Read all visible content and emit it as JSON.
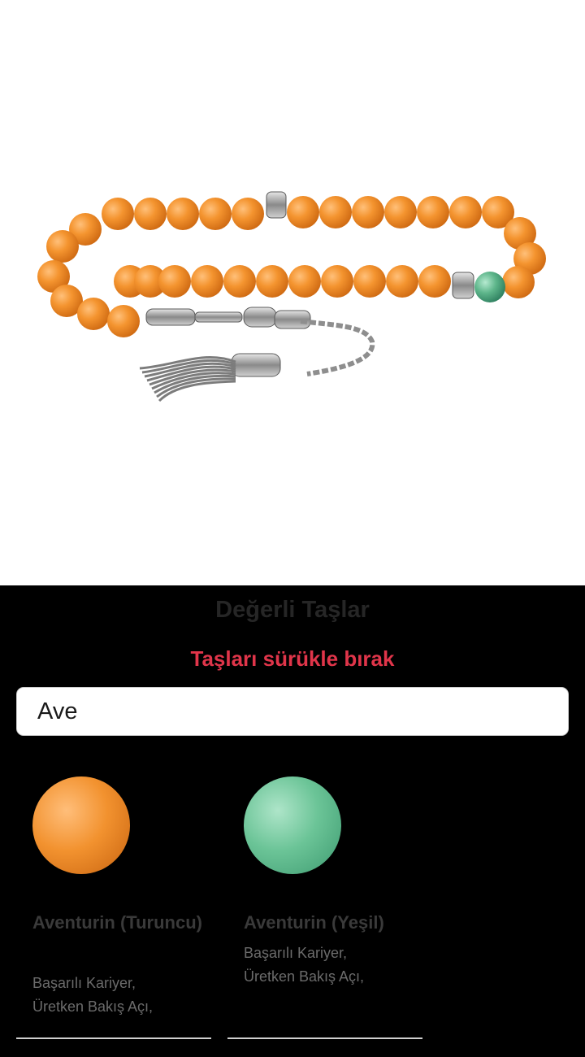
{
  "preview": {
    "main_bead_color": "#f4942f",
    "accent_bead_color": "#5db58a",
    "metal_color": "#8f8f8f"
  },
  "panel": {
    "title": "Değerli Taşlar",
    "subtitle": "Taşları sürükle bırak",
    "search": {
      "value": "Ave",
      "placeholder": ""
    },
    "stones": [
      {
        "name": "Aventurin (Turuncu)",
        "description_lines": [
          "Başarılı Kariyer,",
          "Üretken Bakış Açı,"
        ],
        "color": "#f2922f"
      },
      {
        "name": "Aventurin (Yeşil)",
        "description_lines": [
          "Başarılı Kariyer,",
          "Üretken Bakış Açı,"
        ],
        "color": "#6bc497"
      }
    ]
  },
  "colors": {
    "panel_bg": "#000000",
    "title": "#262626",
    "subtitle": "#e0354a",
    "stone_name": "#3a3a3a",
    "stone_desc": "#6b6b6b"
  }
}
